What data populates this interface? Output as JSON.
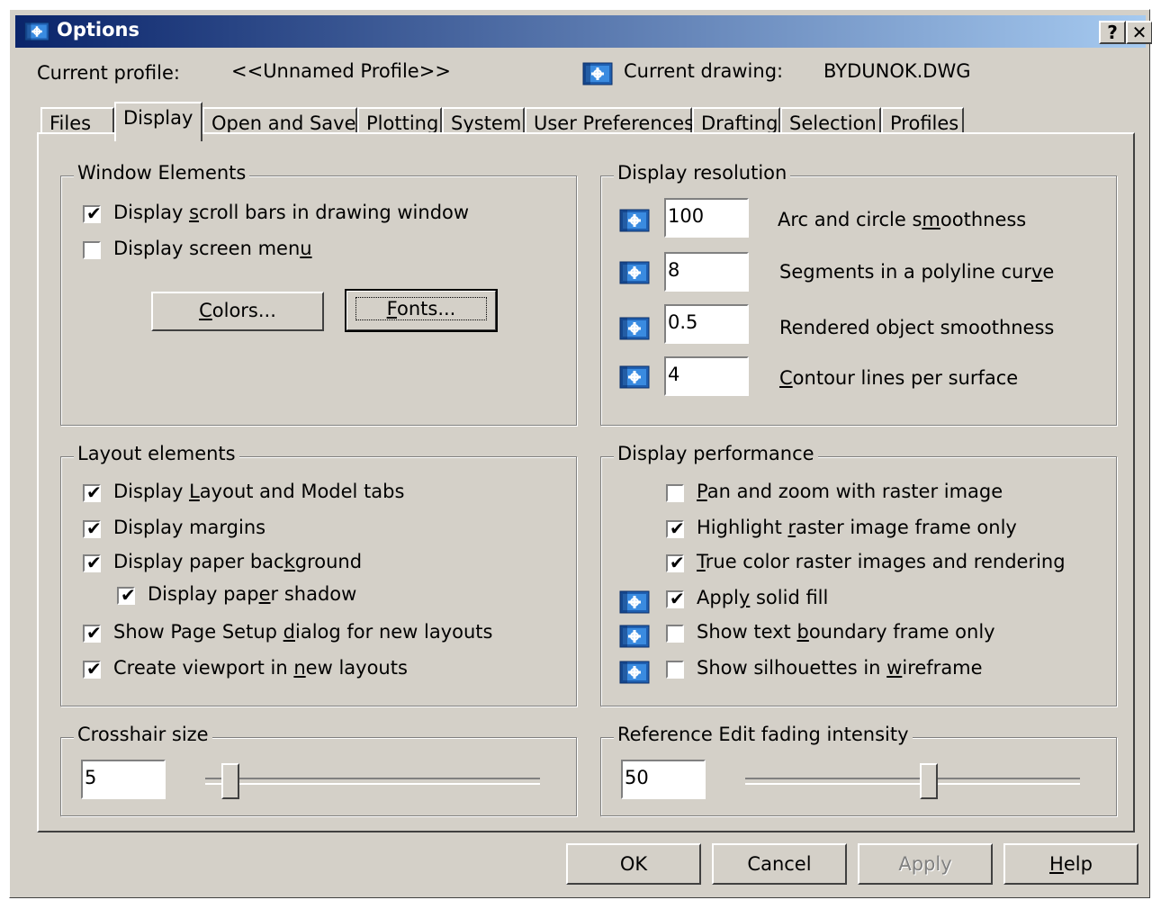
{
  "window": {
    "title": "Options",
    "help_glyph": "?",
    "close_glyph": "✕"
  },
  "header": {
    "current_profile_label": "Current profile:",
    "current_profile_value": "<<Unnamed Profile>>",
    "current_drawing_label": "Current drawing:",
    "current_drawing_value": "BYDUNOK.DWG"
  },
  "tabs": [
    {
      "label": "Files"
    },
    {
      "label": "Display",
      "active": true
    },
    {
      "label": "Open and Save"
    },
    {
      "label": "Plotting"
    },
    {
      "label": "System"
    },
    {
      "label": "User Preferences"
    },
    {
      "label": "Drafting"
    },
    {
      "label": "Selection"
    },
    {
      "label": "Profiles"
    }
  ],
  "window_elements": {
    "title": "Window Elements",
    "scroll_bars": {
      "pre": "Display ",
      "u": "s",
      "post": "croll bars in drawing window",
      "checked": true
    },
    "screen_menu": {
      "pre": "Display screen men",
      "u": "u",
      "post": "",
      "checked": false
    },
    "colors_button": {
      "pre": "",
      "u": "C",
      "post": "olors..."
    },
    "fonts_button": {
      "pre": "",
      "u": "F",
      "post": "onts..."
    }
  },
  "display_resolution": {
    "title": "Display resolution",
    "items": [
      {
        "value": "100",
        "pre": "Arc and circle s",
        "u": "m",
        "post": "oothness"
      },
      {
        "value": "8",
        "pre": "Segments in a polyline cur",
        "u": "v",
        "post": "e"
      },
      {
        "value": "0.5",
        "pre": "Rendered object smoothness",
        "u": "",
        "post": ""
      },
      {
        "value": "4",
        "pre": "",
        "u": "C",
        "post": "ontour lines per surface"
      }
    ]
  },
  "layout_elements": {
    "title": "Layout elements",
    "items": [
      {
        "pre": "Display ",
        "u": "L",
        "post": "ayout and Model tabs",
        "checked": true
      },
      {
        "pre": "Display margins",
        "u": "",
        "post": "",
        "checked": true
      },
      {
        "pre": "Display paper bac",
        "u": "k",
        "post": "ground",
        "checked": true
      },
      {
        "pre": "Display pap",
        "u": "e",
        "post": "r shadow",
        "checked": true
      },
      {
        "pre": "Show Page Setup ",
        "u": "d",
        "post": "ialog for new layouts",
        "checked": true
      },
      {
        "pre": "Create viewport in ",
        "u": "n",
        "post": "ew layouts",
        "checked": true
      }
    ]
  },
  "display_performance": {
    "title": "Display performance",
    "items": [
      {
        "pre": "",
        "u": "P",
        "post": "an and zoom with raster image",
        "checked": false
      },
      {
        "pre": "Highlight ",
        "u": "r",
        "post": "aster image frame only",
        "checked": true
      },
      {
        "pre": "",
        "u": "T",
        "post": "rue color raster images and rendering",
        "checked": true
      },
      {
        "pre": "Appl",
        "u": "y",
        "post": " solid fill",
        "checked": true
      },
      {
        "pre": "Show text ",
        "u": "b",
        "post": "oundary frame only",
        "checked": false
      },
      {
        "pre": "Show silhouettes in ",
        "u": "w",
        "post": "ireframe",
        "checked": false
      }
    ]
  },
  "crosshair": {
    "title": "Crosshair size",
    "value": "5",
    "slider_percent": 5
  },
  "xref_fading": {
    "title": "Reference Edit fading intensity",
    "value": "50",
    "slider_percent": 55
  },
  "footer": {
    "ok": "OK",
    "cancel": "Cancel",
    "apply": "Apply",
    "help_pre": "",
    "help_u": "H",
    "help_post": "elp"
  }
}
